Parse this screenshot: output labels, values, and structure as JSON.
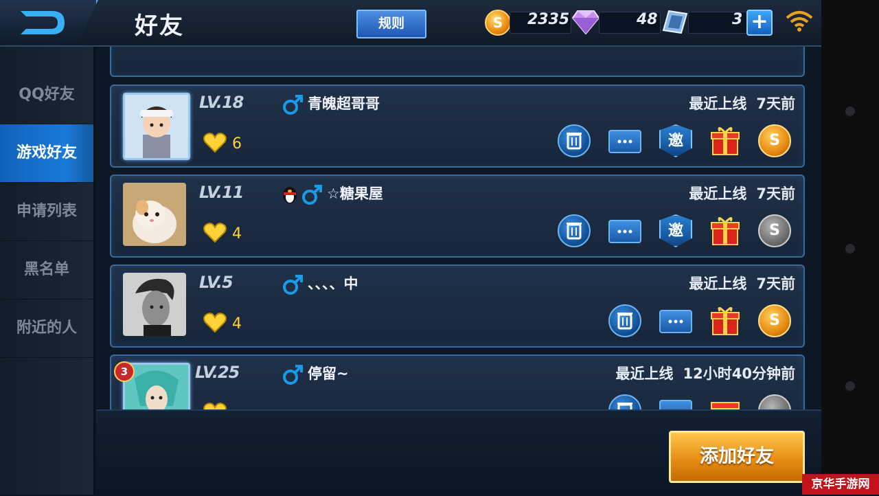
{
  "header": {
    "title": "好友",
    "rules_label": "规则",
    "coins": "2335",
    "coin_icon_letter": "S",
    "diamonds": "48",
    "vouchers": "3",
    "plus_label": "+"
  },
  "sidebar": {
    "items": [
      {
        "label": "QQ好友",
        "active": false
      },
      {
        "label": "游戏好友",
        "active": true
      },
      {
        "label": "申请列表",
        "active": false
      },
      {
        "label": "黑名单",
        "active": false
      },
      {
        "label": "附近的人",
        "active": false
      }
    ]
  },
  "friends": [
    {
      "level": "LV.18",
      "name": "青魄超哥哥",
      "hearts": "6",
      "last_online_label": "最近上线",
      "last_online": "7天前",
      "invite_label": "邀"
    },
    {
      "level": "LV.11",
      "name": "☆糖果屋",
      "hearts": "4",
      "last_online_label": "最近上线",
      "last_online": "7天前",
      "invite_label": "邀"
    },
    {
      "level": "LV.5",
      "name": "、、、、中",
      "hearts": "4",
      "last_online_label": "最近上线",
      "last_online": "7天前"
    },
    {
      "level": "LV.25",
      "name": "停留~",
      "rank_badge": "3",
      "last_online_label": "最近上线",
      "last_online": "12小时40分钟前"
    }
  ],
  "footer": {
    "add_friend_label": "添加好友",
    "watermark": "京华手游网"
  },
  "colors": {
    "accent_blue": "#1a7ad8",
    "heart_yellow": "#ffd23a",
    "gold_button": "#e48a12"
  }
}
